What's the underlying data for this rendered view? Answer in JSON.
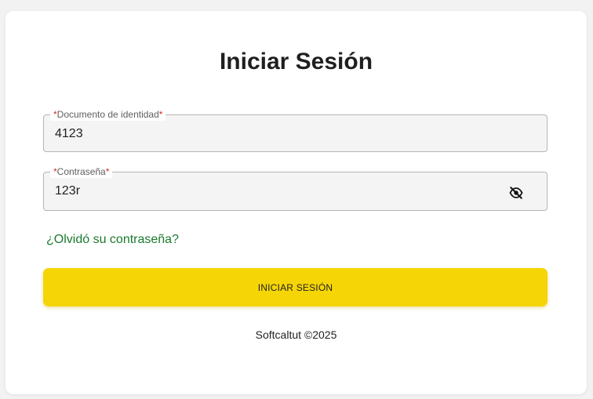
{
  "login": {
    "title": "Iniciar Sesión",
    "document_field": {
      "label_prefix": "*",
      "label": "Documento de identidad",
      "label_suffix": "*",
      "value": "4123"
    },
    "password_field": {
      "label_prefix": "*",
      "label": "Contraseña",
      "label_suffix": "*",
      "value": "123r",
      "toggle_icon": "eye-off-icon"
    },
    "forgot_link": "¿Olvidó su contraseña?",
    "submit_label": "INICIAR SESIÓN",
    "footer": "Softcaltut ©2025"
  },
  "colors": {
    "accent": "#f5d506",
    "link": "#1b7a2e",
    "required": "#d32f2f"
  }
}
